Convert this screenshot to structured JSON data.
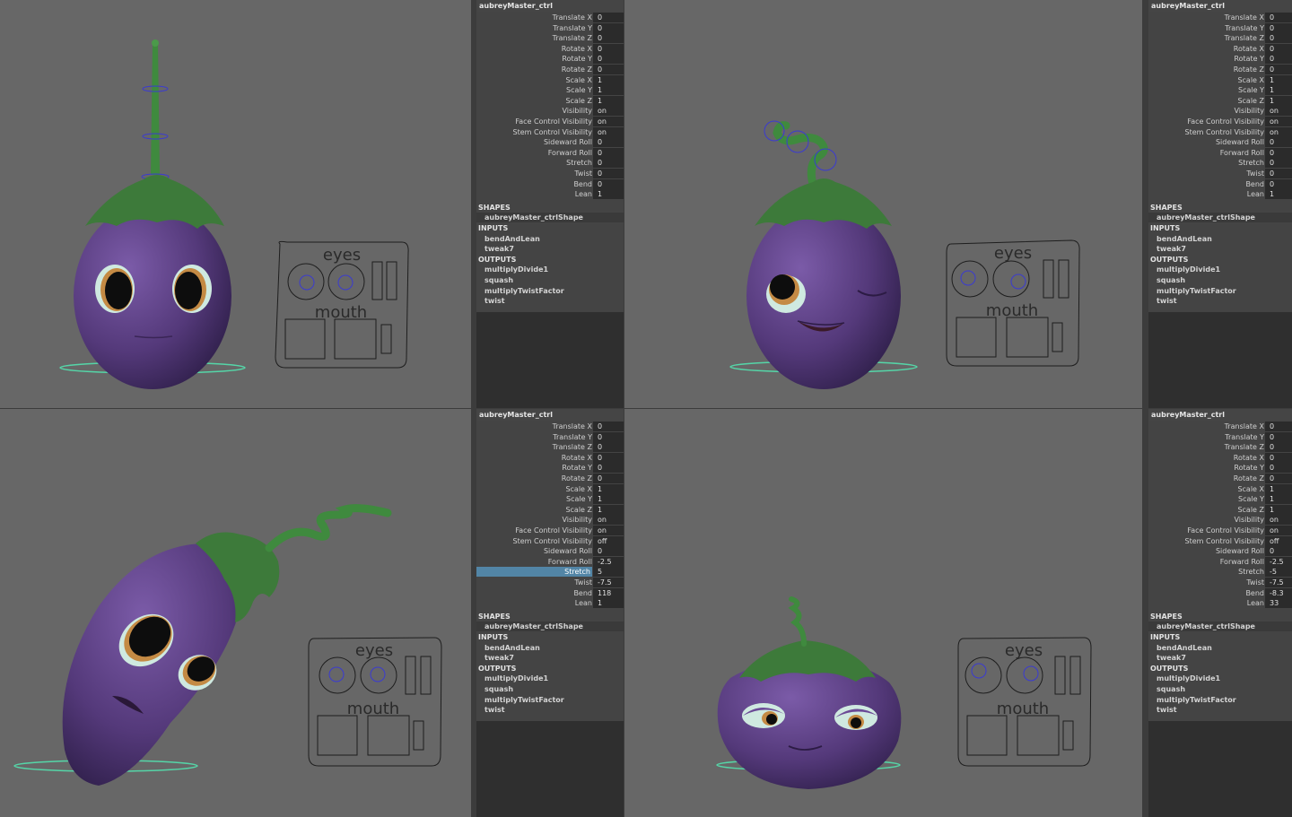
{
  "panels": [
    {
      "node_name": "aubreyMaster_ctrl",
      "attributes": [
        {
          "label": "Translate X",
          "value": "0"
        },
        {
          "label": "Translate Y",
          "value": "0"
        },
        {
          "label": "Translate Z",
          "value": "0"
        },
        {
          "label": "Rotate X",
          "value": "0"
        },
        {
          "label": "Rotate Y",
          "value": "0"
        },
        {
          "label": "Rotate Z",
          "value": "0"
        },
        {
          "label": "Scale X",
          "value": "1"
        },
        {
          "label": "Scale Y",
          "value": "1"
        },
        {
          "label": "Scale Z",
          "value": "1"
        },
        {
          "label": "Visibility",
          "value": "on"
        },
        {
          "label": "Face Control Visibility",
          "value": "on"
        },
        {
          "label": "Stem Control Visibility",
          "value": "on"
        },
        {
          "label": "Sideward Roll",
          "value": "0"
        },
        {
          "label": "Forward Roll",
          "value": "0"
        },
        {
          "label": "Stretch",
          "value": "0"
        },
        {
          "label": "Twist",
          "value": "0"
        },
        {
          "label": "Bend",
          "value": "0"
        },
        {
          "label": "Lean",
          "value": "1"
        }
      ],
      "selected_index": -1
    },
    {
      "node_name": "aubreyMaster_ctrl",
      "attributes": [
        {
          "label": "Translate X",
          "value": "0"
        },
        {
          "label": "Translate Y",
          "value": "0"
        },
        {
          "label": "Translate Z",
          "value": "0"
        },
        {
          "label": "Rotate X",
          "value": "0"
        },
        {
          "label": "Rotate Y",
          "value": "0"
        },
        {
          "label": "Rotate Z",
          "value": "0"
        },
        {
          "label": "Scale X",
          "value": "1"
        },
        {
          "label": "Scale Y",
          "value": "1"
        },
        {
          "label": "Scale Z",
          "value": "1"
        },
        {
          "label": "Visibility",
          "value": "on"
        },
        {
          "label": "Face Control Visibility",
          "value": "on"
        },
        {
          "label": "Stem Control Visibility",
          "value": "on"
        },
        {
          "label": "Sideward Roll",
          "value": "0"
        },
        {
          "label": "Forward Roll",
          "value": "0"
        },
        {
          "label": "Stretch",
          "value": "0"
        },
        {
          "label": "Twist",
          "value": "0"
        },
        {
          "label": "Bend",
          "value": "0"
        },
        {
          "label": "Lean",
          "value": "1"
        }
      ],
      "selected_index": -1
    },
    {
      "node_name": "aubreyMaster_ctrl",
      "attributes": [
        {
          "label": "Translate X",
          "value": "0"
        },
        {
          "label": "Translate Y",
          "value": "0"
        },
        {
          "label": "Translate Z",
          "value": "0"
        },
        {
          "label": "Rotate X",
          "value": "0"
        },
        {
          "label": "Rotate Y",
          "value": "0"
        },
        {
          "label": "Rotate Z",
          "value": "0"
        },
        {
          "label": "Scale X",
          "value": "1"
        },
        {
          "label": "Scale Y",
          "value": "1"
        },
        {
          "label": "Scale Z",
          "value": "1"
        },
        {
          "label": "Visibility",
          "value": "on"
        },
        {
          "label": "Face Control Visibility",
          "value": "on"
        },
        {
          "label": "Stem Control Visibility",
          "value": "off"
        },
        {
          "label": "Sideward Roll",
          "value": "0"
        },
        {
          "label": "Forward Roll",
          "value": "-2.5"
        },
        {
          "label": "Stretch",
          "value": "5"
        },
        {
          "label": "Twist",
          "value": "-7.5"
        },
        {
          "label": "Bend",
          "value": "118"
        },
        {
          "label": "Lean",
          "value": "1"
        }
      ],
      "selected_index": 14
    },
    {
      "node_name": "aubreyMaster_ctrl",
      "attributes": [
        {
          "label": "Translate X",
          "value": "0"
        },
        {
          "label": "Translate Y",
          "value": "0"
        },
        {
          "label": "Translate Z",
          "value": "0"
        },
        {
          "label": "Rotate X",
          "value": "0"
        },
        {
          "label": "Rotate Y",
          "value": "0"
        },
        {
          "label": "Rotate Z",
          "value": "0"
        },
        {
          "label": "Scale X",
          "value": "1"
        },
        {
          "label": "Scale Y",
          "value": "1"
        },
        {
          "label": "Scale Z",
          "value": "1"
        },
        {
          "label": "Visibility",
          "value": "on"
        },
        {
          "label": "Face Control Visibility",
          "value": "on"
        },
        {
          "label": "Stem Control Visibility",
          "value": "off"
        },
        {
          "label": "Sideward Roll",
          "value": "0"
        },
        {
          "label": "Forward Roll",
          "value": "-2.5"
        },
        {
          "label": "Stretch",
          "value": "-5"
        },
        {
          "label": "Twist",
          "value": "-7.5"
        },
        {
          "label": "Bend",
          "value": "-8.3"
        },
        {
          "label": "Lean",
          "value": "33"
        }
      ],
      "selected_index": -1
    }
  ],
  "sections": {
    "shapes_header": "SHAPES",
    "shape_item": "aubreyMaster_ctrlShape",
    "inputs_header": "INPUTS",
    "inputs": [
      "bendAndLean",
      "tweak7"
    ],
    "outputs_header": "OUTPUTS",
    "outputs": [
      "multiplyDivide1",
      "squash",
      "multiplyTwistFactor",
      "twist"
    ]
  },
  "face_panel": {
    "eyes_label": "eyes",
    "mouth_label": "mouth"
  },
  "colors": {
    "viewport_bg": "#676767",
    "body_purple": "#5a3f82",
    "cap_green": "#3d7a3a",
    "control_ring": "#55d6a8",
    "selection_blue": "#5285a6"
  }
}
